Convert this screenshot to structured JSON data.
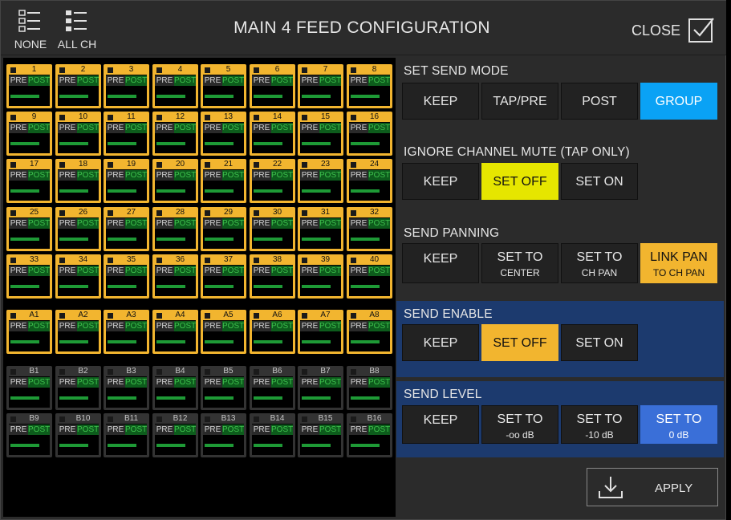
{
  "header": {
    "none_label": "NONE",
    "all_ch_label": "ALL CH",
    "title": "MAIN 4 FEED CONFIGURATION",
    "close_label": "CLOSE"
  },
  "grid": {
    "pre_label": "PRE",
    "post_label": "POST",
    "channels_selected": [
      "1",
      "2",
      "3",
      "4",
      "5",
      "6",
      "7",
      "8",
      "9",
      "10",
      "11",
      "12",
      "13",
      "14",
      "15",
      "16",
      "17",
      "18",
      "19",
      "20",
      "21",
      "22",
      "23",
      "24",
      "25",
      "26",
      "27",
      "28",
      "29",
      "30",
      "31",
      "32",
      "33",
      "34",
      "35",
      "36",
      "37",
      "38",
      "39",
      "40"
    ],
    "aux_a_selected": [
      "A1",
      "A2",
      "A3",
      "A4",
      "A5",
      "A6",
      "A7",
      "A8"
    ],
    "aux_b_unselected": [
      "B1",
      "B2",
      "B3",
      "B4",
      "B5",
      "B6",
      "B7",
      "B8",
      "B9",
      "B10",
      "B11",
      "B12",
      "B13",
      "B14",
      "B15",
      "B16"
    ]
  },
  "sections": {
    "send_mode": {
      "title": "SET SEND MODE",
      "buttons": [
        "KEEP",
        "TAP/PRE",
        "POST",
        "GROUP"
      ],
      "selected": "GROUP"
    },
    "ignore_mute": {
      "title": "IGNORE CHANNEL MUTE (TAP ONLY)",
      "buttons": [
        "KEEP",
        "SET OFF",
        "SET ON"
      ],
      "selected": "SET OFF"
    },
    "send_panning": {
      "title": "SEND PANNING",
      "buttons": [
        {
          "l1": "KEEP",
          "l2": ""
        },
        {
          "l1": "SET TO",
          "l2": "CENTER"
        },
        {
          "l1": "SET TO",
          "l2": "CH PAN"
        },
        {
          "l1": "LINK PAN",
          "l2": "TO CH PAN"
        }
      ],
      "selected": "LINK PAN"
    },
    "send_enable": {
      "title": "SEND ENABLE",
      "buttons": [
        "KEEP",
        "SET OFF",
        "SET ON"
      ],
      "selected": "SET OFF"
    },
    "send_level": {
      "title": "SEND LEVEL",
      "buttons": [
        {
          "l1": "KEEP",
          "l2": ""
        },
        {
          "l1": "SET TO",
          "l2": "-oo dB"
        },
        {
          "l1": "SET TO",
          "l2": "-10 dB"
        },
        {
          "l1": "SET TO",
          "l2": "0 dB"
        }
      ],
      "selected": "0 dB"
    }
  },
  "footer": {
    "apply_label": "APPLY"
  },
  "colors": {
    "selected_tile": "#f2b52f",
    "group_active": "#0aa2f5",
    "mute_off_active": "#e6e600",
    "enable_off_active": "#f2b52f",
    "level_active": "#3a6fd8",
    "post_green": "#3ec24d"
  }
}
